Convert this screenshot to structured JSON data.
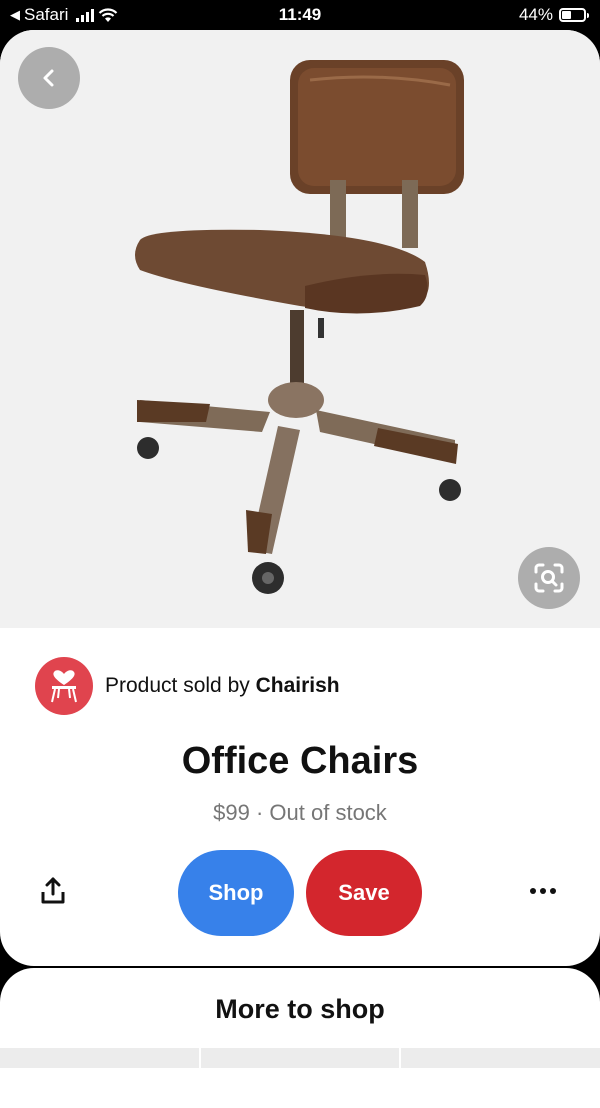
{
  "status_bar": {
    "back_app": "Safari",
    "time": "11:49",
    "battery": "44%",
    "battery_level": 0.44
  },
  "seller": {
    "prefix": "Product sold by",
    "name": "Chairish"
  },
  "product": {
    "title": "Office Chairs",
    "price_line": "$99 · Out of stock"
  },
  "actions": {
    "shop_label": "Shop",
    "save_label": "Save"
  },
  "more": {
    "title": "More to shop"
  },
  "icons": {
    "back": "chevron-left-icon",
    "visual_search": "lens-search-icon",
    "share": "share-icon",
    "more": "more-dots-icon"
  },
  "colors": {
    "shop": "#3781ea",
    "save": "#d3262d",
    "seller_logo": "#e0444e"
  }
}
